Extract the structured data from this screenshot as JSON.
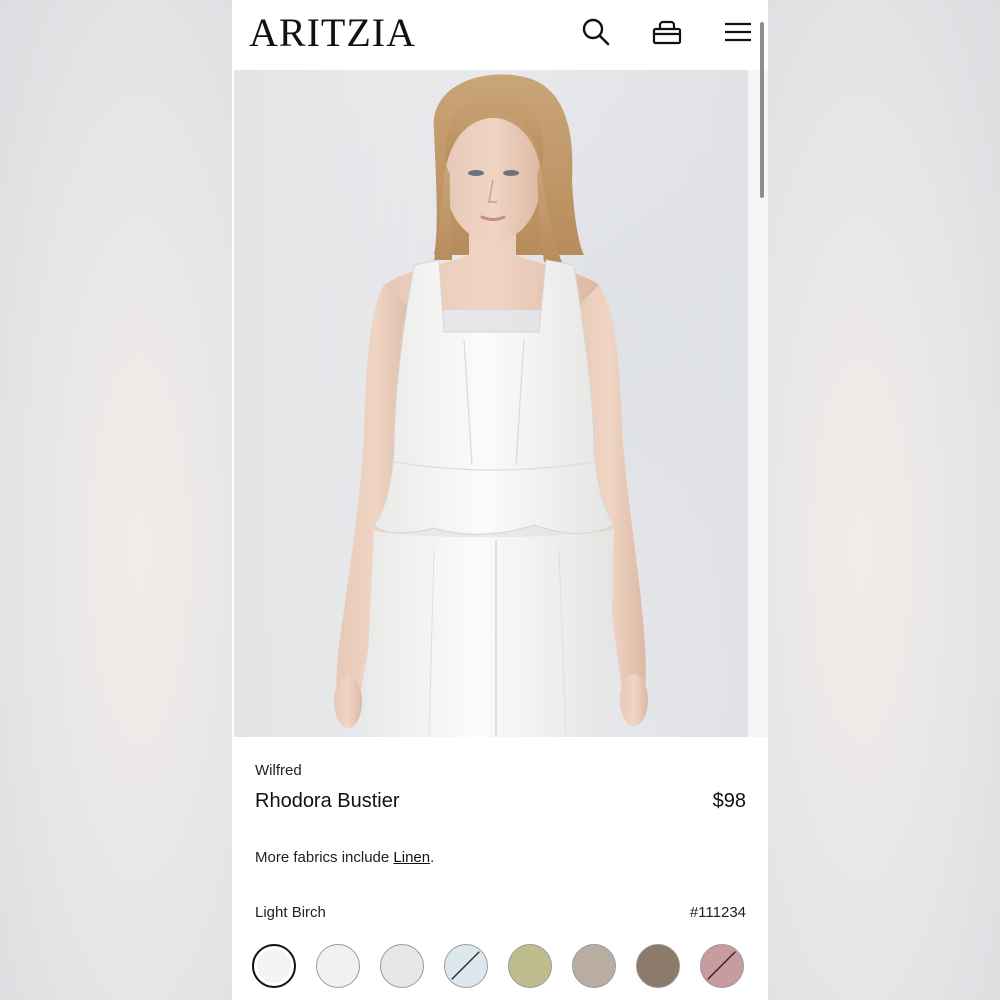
{
  "header": {
    "logo": "ARITZIA",
    "icons": [
      "search-icon",
      "bag-icon",
      "menu-icon"
    ]
  },
  "product": {
    "brand": "Wilfred",
    "name": "Rhodora Bustier",
    "price": "$98",
    "fabrics_prefix": "More fabrics include ",
    "fabrics_link": "Linen",
    "fabrics_suffix": ".",
    "color_name": "Light Birch",
    "color_code": "#111234"
  },
  "swatches": [
    {
      "color": "#f5f4f2",
      "selected": true,
      "unavailable": false
    },
    {
      "color": "#f1f1f0",
      "selected": false,
      "unavailable": false
    },
    {
      "color": "#e6e8e6",
      "selected": false,
      "unavailable": false
    },
    {
      "color": "#dde8ee",
      "selected": false,
      "unavailable": true
    },
    {
      "color": "#bfbd8e",
      "selected": false,
      "unavailable": false
    },
    {
      "color": "#b9aca0",
      "selected": false,
      "unavailable": false
    },
    {
      "color": "#8c7a6a",
      "selected": false,
      "unavailable": false
    },
    {
      "color": "#c99a9e",
      "selected": false,
      "unavailable": true
    }
  ],
  "colors": {
    "text": "#111111",
    "background": "#ffffff",
    "hero_background": "#e7e8ea"
  }
}
